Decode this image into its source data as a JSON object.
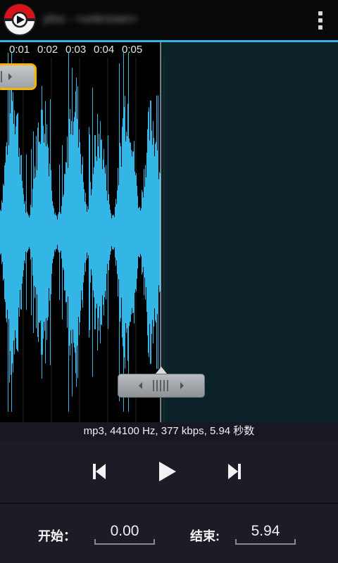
{
  "app": {
    "title": "plss - <unknown>",
    "logo_icon": "record-play-logo-icon",
    "menu_icon": "overflow-menu-icon"
  },
  "waveform": {
    "time_ticks": [
      "0:01",
      "0:02",
      "0:03",
      "0:04",
      "0:05"
    ],
    "selection_color": "#33b5e5",
    "unselected_bg": "#0b2229",
    "start_handle_border": "#f7b500"
  },
  "info": {
    "text": "mp3, 44100 Hz, 377 kbps, 5.94 秒数"
  },
  "controls": {
    "rewind_icon": "skip-to-start-icon",
    "play_icon": "play-icon",
    "forward_icon": "skip-to-end-icon"
  },
  "fields": {
    "start_label": "开始：",
    "start_value": "0.00",
    "end_label": "结束:",
    "end_value": "5.94"
  }
}
